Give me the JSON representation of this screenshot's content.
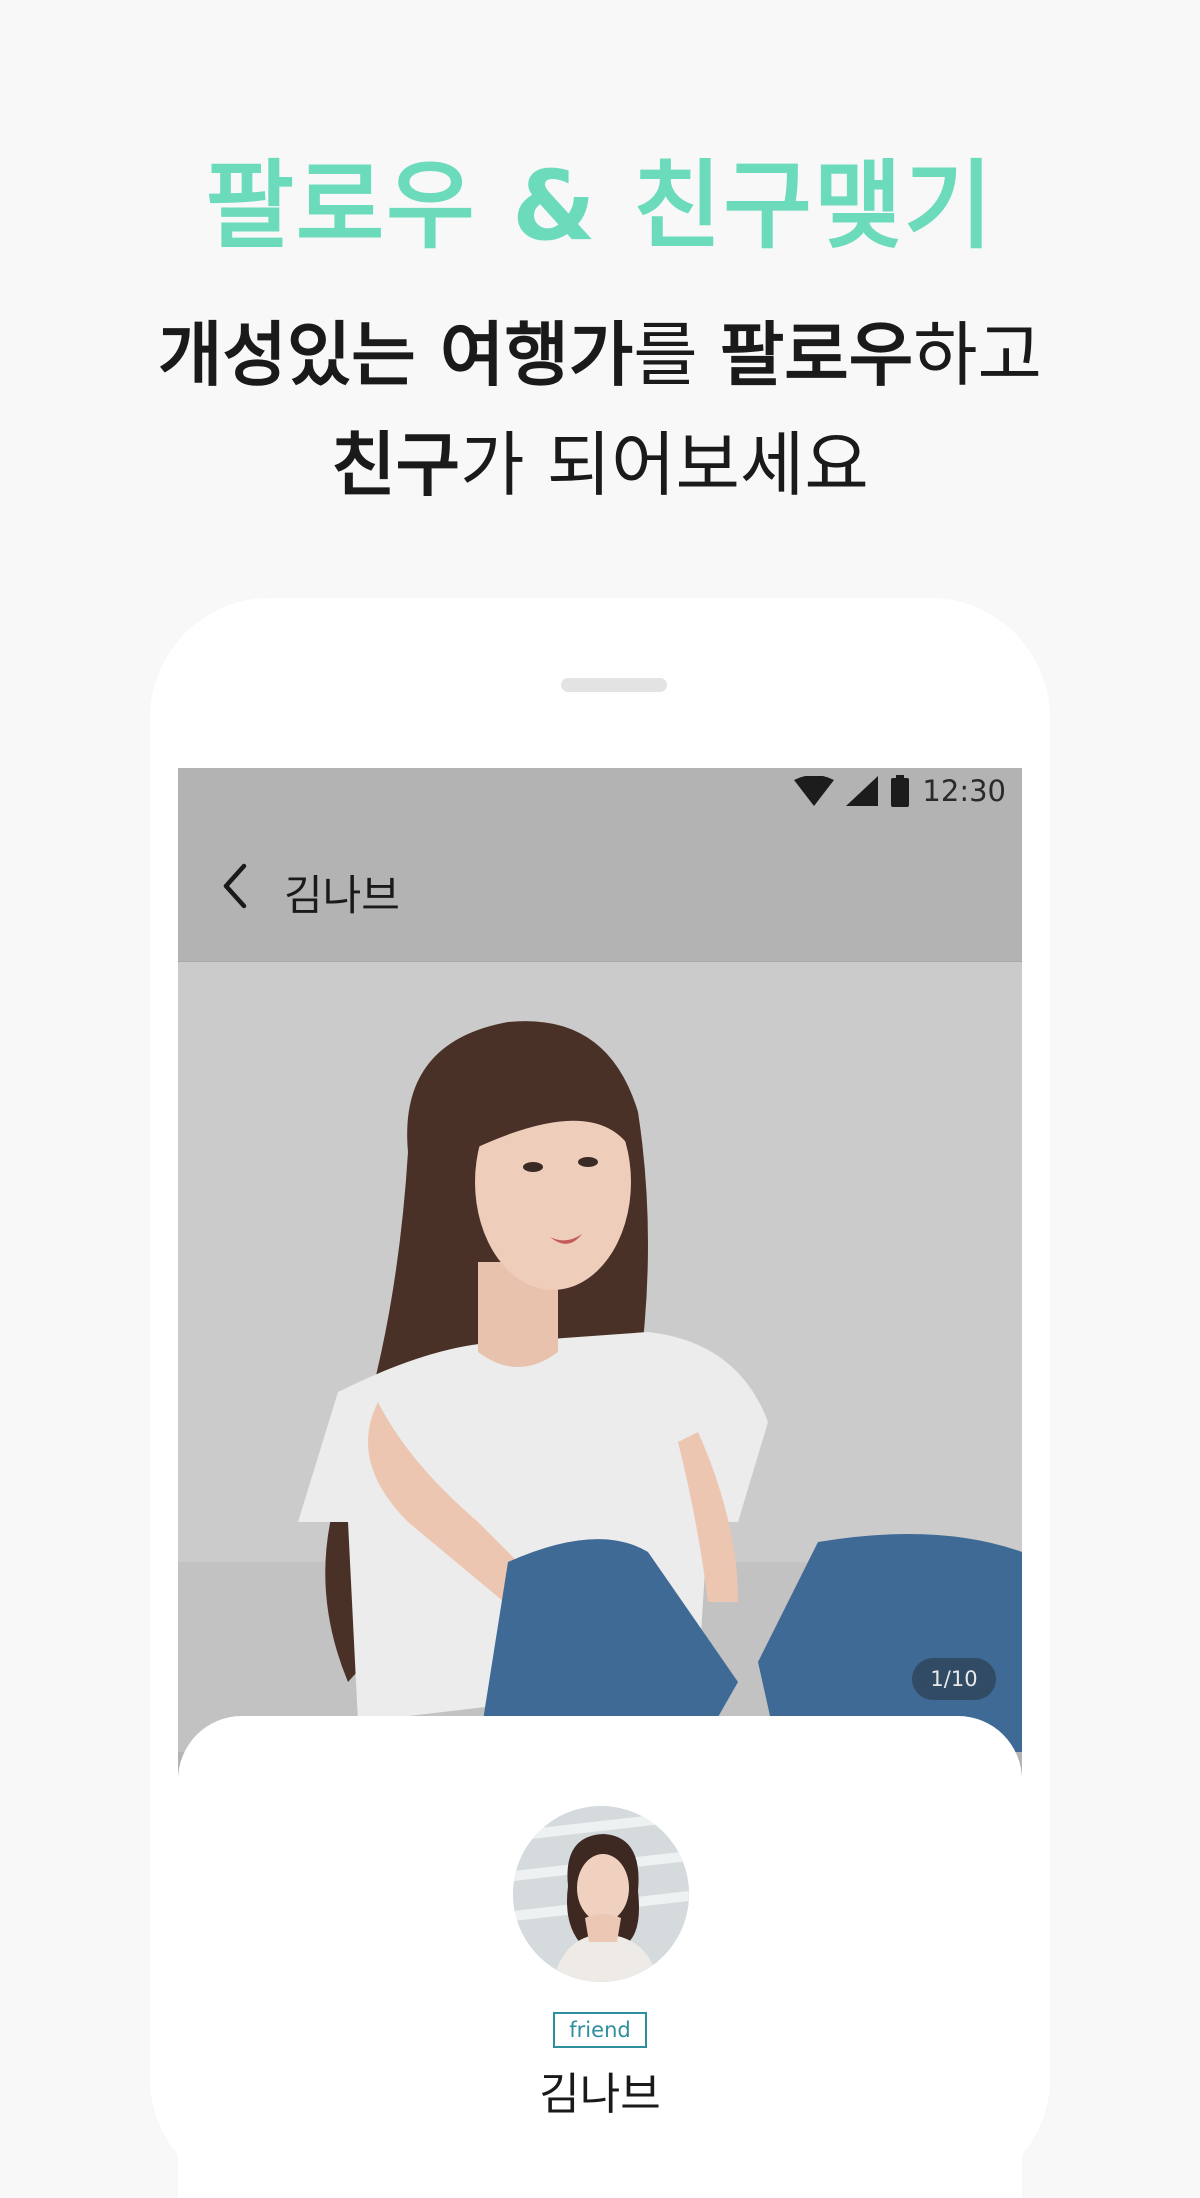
{
  "colors": {
    "accent": "#6cdbbc",
    "badge": "#2f8e9e",
    "background": "#f8f8f8"
  },
  "promo": {
    "title": "팔로우 & 친구맺기",
    "line1": {
      "bold1": "개성있는 여행가",
      "normal1": "를 ",
      "bold2": "팔로우",
      "normal2": "하고"
    },
    "line2": {
      "bold": "친구",
      "normal": "가 되어보세요"
    }
  },
  "status_bar": {
    "time": "12:30",
    "icons": [
      "wifi-icon",
      "signal-icon",
      "battery-icon"
    ]
  },
  "profile_screen": {
    "header_title": "김나브",
    "photo_counter": "1/10",
    "badge": "friend",
    "name": "김나브"
  }
}
